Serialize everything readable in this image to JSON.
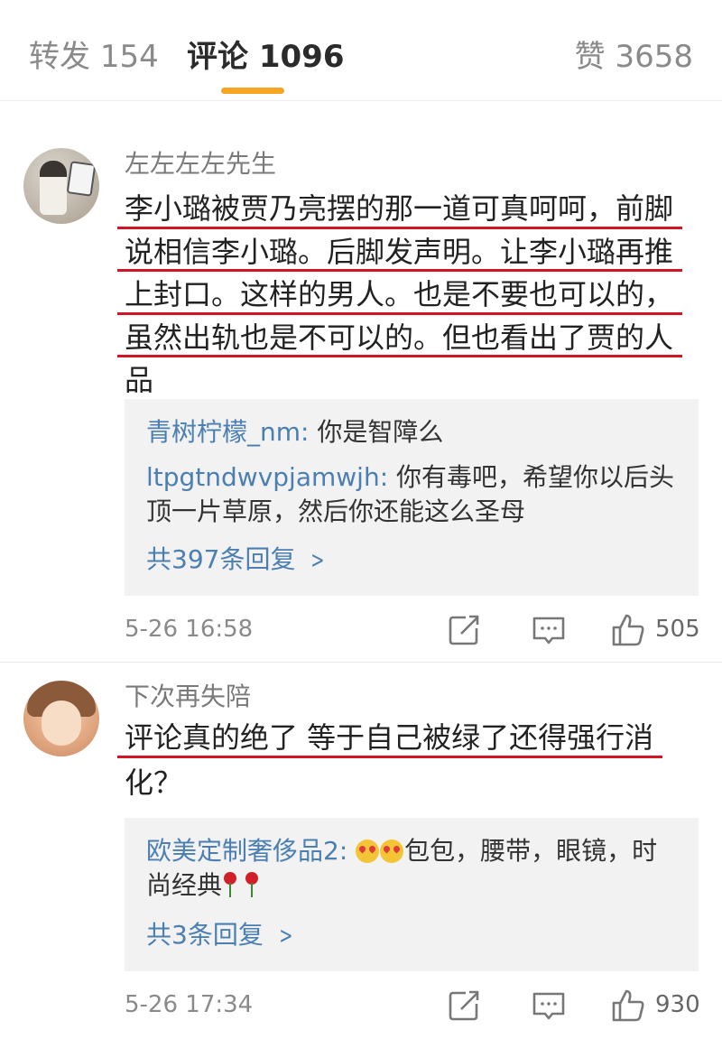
{
  "tabs": {
    "repost_label": "转发",
    "repost_count": "154",
    "comment_label": "评论",
    "comment_count": "1096",
    "like_label": "赞",
    "like_count": "3658"
  },
  "colors": {
    "accent_underline": "#f6a623",
    "link_blue": "#4b7fb2",
    "annotation_red": "#d21424"
  },
  "comments": [
    {
      "username": "左左左左先生",
      "lines": [
        "李小璐被贾乃亮摆的那一道可真呵呵，前脚",
        "说相信李小璐。后脚发声明。让李小璐再推",
        "上封口。这样的男人。也是不要也可以的，",
        "虽然出轨也是不可以的。但也看出了贾的人",
        "品"
      ],
      "replies": [
        {
          "name": "青树柠檬_nm",
          "text": "你是智障么"
        },
        {
          "name": "ltpgtndwvpjamwjh",
          "text": "你有毒吧，希望你以后头",
          "text2": "顶一片草原，然后你还能这么圣母"
        }
      ],
      "more_replies": "共397条回复",
      "time": "5-26 16:58",
      "likes": "505"
    },
    {
      "username": "下次再失陪",
      "lines": [
        "评论真的绝了 等于自己被绿了还得强行消",
        "化？"
      ],
      "replies": [
        {
          "name": "欧美定制奢侈品2",
          "text": "包包，腰带，眼镜，时",
          "text2": "尚经典"
        }
      ],
      "more_replies": "共3条回复",
      "time": "5-26 17:34",
      "likes": "930"
    }
  ],
  "icons": [
    "repost-icon",
    "comment-icon",
    "like-icon",
    "chevron-right-icon",
    "heart-eyes-emoji-icon",
    "rose-emoji-icon"
  ]
}
